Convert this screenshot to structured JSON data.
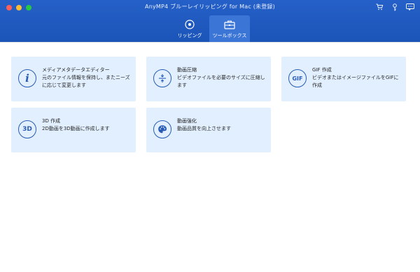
{
  "window": {
    "title": "AnyMP4 ブルーレイリッピング for Mac (未登録)"
  },
  "toolbar_icons": [
    "cart-icon",
    "key-icon",
    "message-icon"
  ],
  "tabs": [
    {
      "label": "リッピング",
      "icon": "disc-icon",
      "active": false
    },
    {
      "label": "ツールボックス",
      "icon": "toolbox-icon",
      "active": true
    }
  ],
  "cards": [
    {
      "title": "メディアメタデータエディター",
      "description": "元のファイル情報を保持し、またニーズに応じて変更します",
      "icon_label": "i"
    },
    {
      "title": "動画圧縮",
      "description": "ビデオファイルを必要のサイズに圧縮します",
      "icon_label": ""
    },
    {
      "title": "GIF 作成",
      "description": "ビデオまたはイメージファイルをGIFに作成",
      "icon_label": "GIF"
    },
    {
      "title": "3D 作成",
      "description": "2D動画を3D動画に作成します",
      "icon_label": "3D"
    },
    {
      "title": "動画強化",
      "description": "動画品質を向上させます",
      "icon_label": ""
    }
  ],
  "colors": {
    "header": "#1c55b8",
    "active_tab": "#3b75d6",
    "card_bg": "#e1efff",
    "icon": "#2a5cb5"
  }
}
